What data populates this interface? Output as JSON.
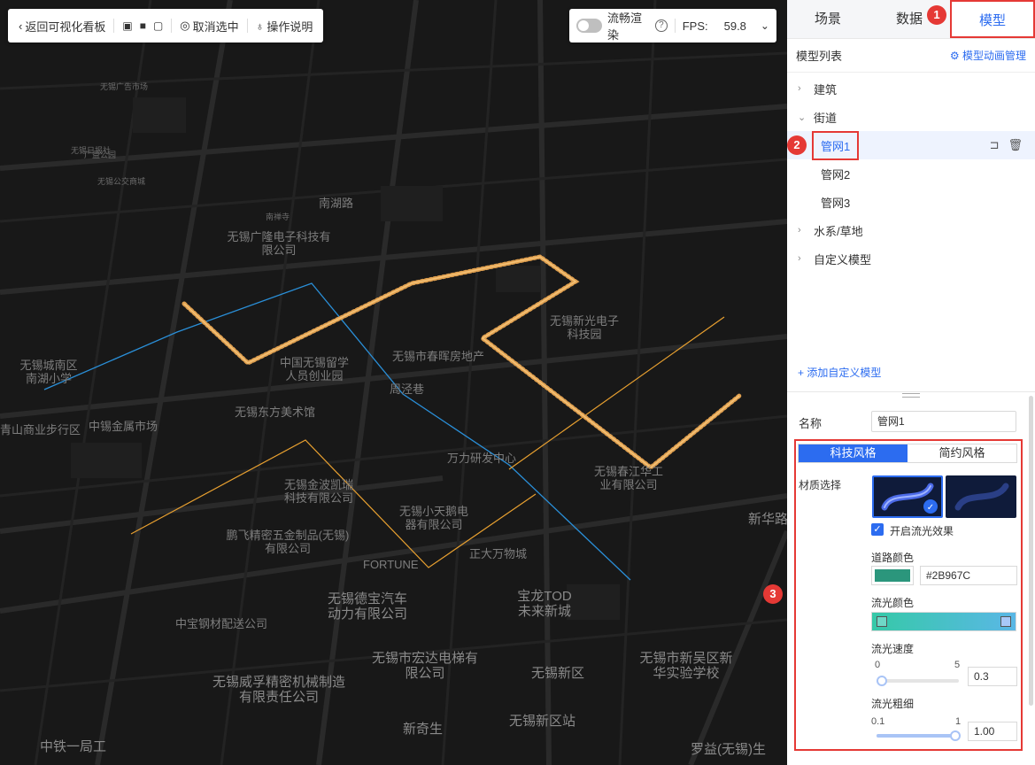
{
  "toolbar": {
    "back_label": "返回可视化看板",
    "deselect_label": "取消选中",
    "help_label": "操作说明"
  },
  "fps_bar": {
    "smooth_label": "流畅渲染",
    "fps_label": "FPS:",
    "fps_value": "59.8"
  },
  "tabs": [
    {
      "label": "场景"
    },
    {
      "label": "数据",
      "badge": "1"
    },
    {
      "label": "模型",
      "active": true
    }
  ],
  "model_list": {
    "title": "模型列表",
    "anim_manage": "模型动画管理",
    "groups": [
      {
        "label": "建筑",
        "expanded": false
      },
      {
        "label": "街道",
        "expanded": true,
        "children": [
          "管网1",
          "管网2",
          "管网3"
        ]
      },
      {
        "label": "水系/草地",
        "expanded": false
      },
      {
        "label": "自定义模型",
        "expanded": false
      }
    ],
    "selected_badge": "2",
    "add_custom": "添加自定义模型"
  },
  "props": {
    "name_label": "名称",
    "name_value": "管网1",
    "style_tabs": [
      "科技风格",
      "简约风格"
    ],
    "section_badge": "3",
    "material_label": "材质选择",
    "flow_effect_label": "开启流光效果",
    "road_color_label": "道路颜色",
    "road_color_hex": "#2B967C",
    "flow_color_label": "流光颜色",
    "flow_speed_label": "流光速度",
    "flow_speed_min": "0",
    "flow_speed_max": "5",
    "flow_speed_value": "0.3",
    "flow_width_label": "流光粗细",
    "flow_width_min": "0.1",
    "flow_width_max": "1",
    "flow_width_value": "1.00"
  },
  "colors": {
    "accent": "#2c6cf0",
    "annotation_red": "#e53935",
    "pipe_orange": "#e8a030",
    "pipe_blue": "#2a8fd8",
    "road_color": "#2B967C"
  },
  "map_labels": [
    "无锡广告市场",
    "无锡日报社",
    "广益公园",
    "南湖路",
    "无锡公交商城",
    "南禅寺",
    "无锡新光电子科技园",
    "无锡广隆电子科技有限公司",
    "无锡市春晖房地产",
    "中国无锡留学人员创业园",
    "周泾巷",
    "无锡东方美术馆",
    "中锡金属市场",
    "无锡城南区南湖小学",
    "青山商业步行区",
    "无锡威孚精密机械制造有限责任公司",
    "无锡市宏达电梯有限公司",
    "中宝钢材配送公司",
    "无锡德宝汽车动力有限公司",
    "无锡新区",
    "无锡新区站",
    "宝龙TOD未来新城",
    "无锡市新吴区新华实验学校",
    "新奇生",
    "中铁一局工",
    "无锡小天鹅电器有限公司",
    "正大万物城",
    "FORTUNE",
    "鹏飞精密五金制品(无锡)有限公司",
    "无锡金波凯瑞科技有限公司",
    "万力研发中心",
    "无锡春江华工业有限公司",
    "新华路",
    "罗益(无锡)生"
  ]
}
